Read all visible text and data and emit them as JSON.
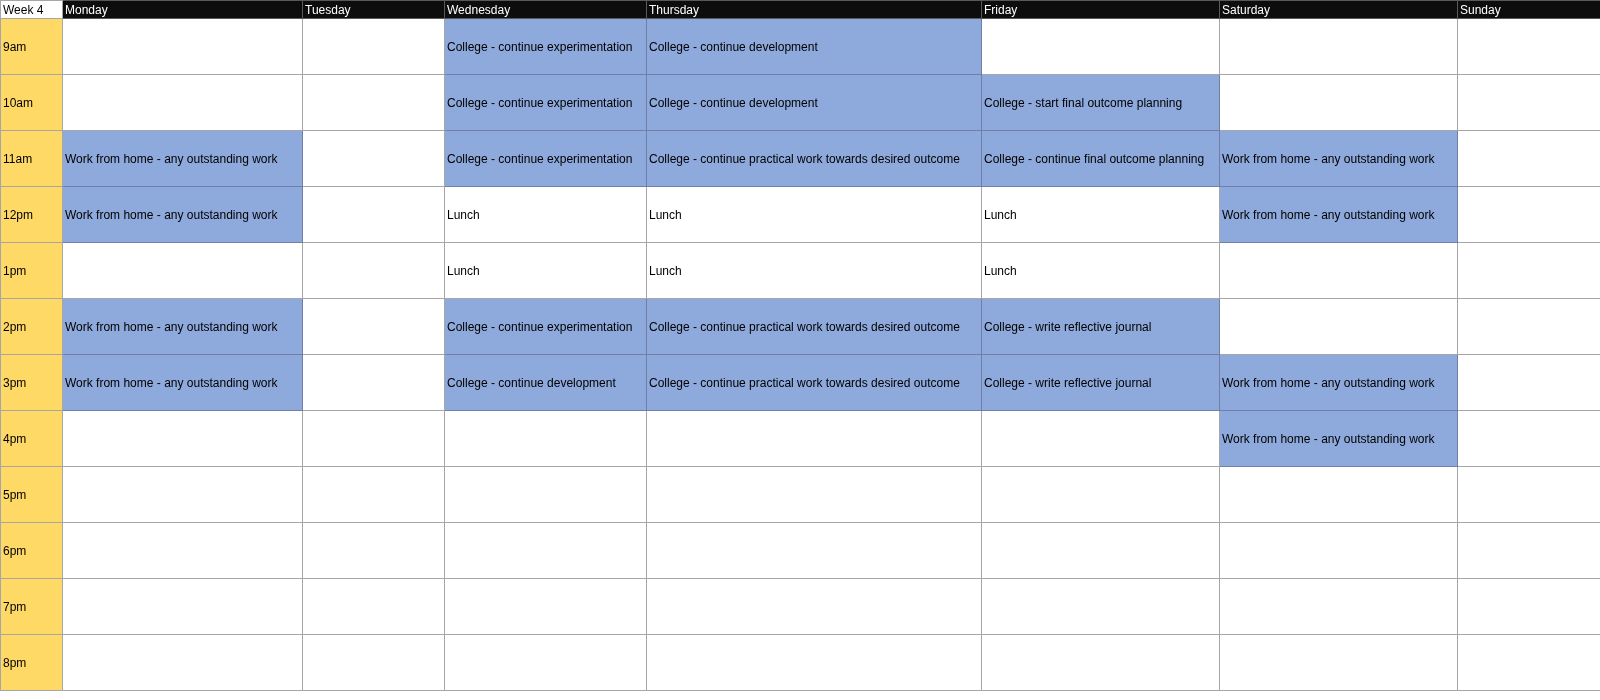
{
  "header": {
    "corner": "Week 4",
    "days": [
      "Monday",
      "Tuesday",
      "Wednesday",
      "Thursday",
      "Friday",
      "Saturday",
      "Sunday"
    ]
  },
  "rows": [
    {
      "time": "9am",
      "cells": [
        {
          "highlighted": false
        },
        {
          "highlighted": false
        },
        {
          "text": "College - continue experimentation",
          "highlighted": true
        },
        {
          "text": "College - continue development",
          "highlighted": true
        },
        {
          "highlighted": false
        },
        {
          "highlighted": false
        },
        {
          "highlighted": false
        }
      ]
    },
    {
      "time": "10am",
      "cells": [
        {
          "highlighted": false
        },
        {
          "highlighted": false
        },
        {
          "text": "College - continue experimentation",
          "highlighted": true
        },
        {
          "text": "College - continue development",
          "highlighted": true
        },
        {
          "text": "College - start final outcome planning",
          "highlighted": true
        },
        {
          "highlighted": false
        },
        {
          "highlighted": false
        }
      ]
    },
    {
      "time": "11am",
      "cells": [
        {
          "text": "Work from home - any outstanding work",
          "highlighted": true
        },
        {
          "highlighted": false
        },
        {
          "text": "College - continue experimentation",
          "highlighted": true
        },
        {
          "text": "College - continue practical work towards desired outcome",
          "highlighted": true
        },
        {
          "text": "College - continue final outcome planning",
          "highlighted": true
        },
        {
          "text": "Work from home - any outstanding work",
          "highlighted": true
        },
        {
          "highlighted": false
        }
      ]
    },
    {
      "time": "12pm",
      "cells": [
        {
          "text": "Work from home - any outstanding work",
          "highlighted": true
        },
        {
          "highlighted": false
        },
        {
          "text": "Lunch",
          "highlighted": false
        },
        {
          "text": "Lunch",
          "highlighted": false
        },
        {
          "text": "Lunch",
          "highlighted": false
        },
        {
          "text": "Work from home - any outstanding work",
          "highlighted": true
        },
        {
          "highlighted": false
        }
      ]
    },
    {
      "time": "1pm",
      "cells": [
        {
          "highlighted": false
        },
        {
          "highlighted": false
        },
        {
          "text": "Lunch",
          "highlighted": false
        },
        {
          "text": "Lunch",
          "highlighted": false
        },
        {
          "text": "Lunch",
          "highlighted": false
        },
        {
          "highlighted": false
        },
        {
          "highlighted": false
        }
      ]
    },
    {
      "time": "2pm",
      "cells": [
        {
          "text": "Work from home - any outstanding work",
          "highlighted": true
        },
        {
          "highlighted": false
        },
        {
          "text": "College - continue experimentation",
          "highlighted": true
        },
        {
          "text": "College - continue practical work towards desired outcome",
          "highlighted": true
        },
        {
          "text": "College - write reflective journal",
          "highlighted": true
        },
        {
          "highlighted": false
        },
        {
          "highlighted": false
        }
      ]
    },
    {
      "time": "3pm",
      "cells": [
        {
          "text": "Work from home - any outstanding work",
          "highlighted": true
        },
        {
          "highlighted": false
        },
        {
          "text": "College - continue development",
          "highlighted": true
        },
        {
          "text": "College - continue practical work towards desired outcome",
          "highlighted": true
        },
        {
          "text": "College - write reflective journal",
          "highlighted": true
        },
        {
          "text": "Work from home - any outstanding work",
          "highlighted": true
        },
        {
          "highlighted": false
        }
      ]
    },
    {
      "time": "4pm",
      "cells": [
        {
          "highlighted": false
        },
        {
          "highlighted": false
        },
        {
          "highlighted": false
        },
        {
          "highlighted": false
        },
        {
          "highlighted": false
        },
        {
          "text": "Work from home - any outstanding work",
          "highlighted": true
        },
        {
          "highlighted": false
        }
      ]
    },
    {
      "time": "5pm",
      "cells": [
        {
          "highlighted": false
        },
        {
          "highlighted": false
        },
        {
          "highlighted": false
        },
        {
          "highlighted": false
        },
        {
          "highlighted": false
        },
        {
          "highlighted": false
        },
        {
          "highlighted": false
        }
      ]
    },
    {
      "time": "6pm",
      "cells": [
        {
          "highlighted": false
        },
        {
          "highlighted": false
        },
        {
          "highlighted": false
        },
        {
          "highlighted": false
        },
        {
          "highlighted": false
        },
        {
          "highlighted": false
        },
        {
          "highlighted": false
        }
      ]
    },
    {
      "time": "7pm",
      "cells": [
        {
          "highlighted": false
        },
        {
          "highlighted": false
        },
        {
          "highlighted": false
        },
        {
          "highlighted": false
        },
        {
          "highlighted": false
        },
        {
          "highlighted": false
        },
        {
          "highlighted": false
        }
      ]
    },
    {
      "time": "8pm",
      "cells": [
        {
          "highlighted": false
        },
        {
          "highlighted": false
        },
        {
          "highlighted": false
        },
        {
          "highlighted": false
        },
        {
          "highlighted": false
        },
        {
          "highlighted": false
        },
        {
          "highlighted": false
        }
      ]
    }
  ]
}
